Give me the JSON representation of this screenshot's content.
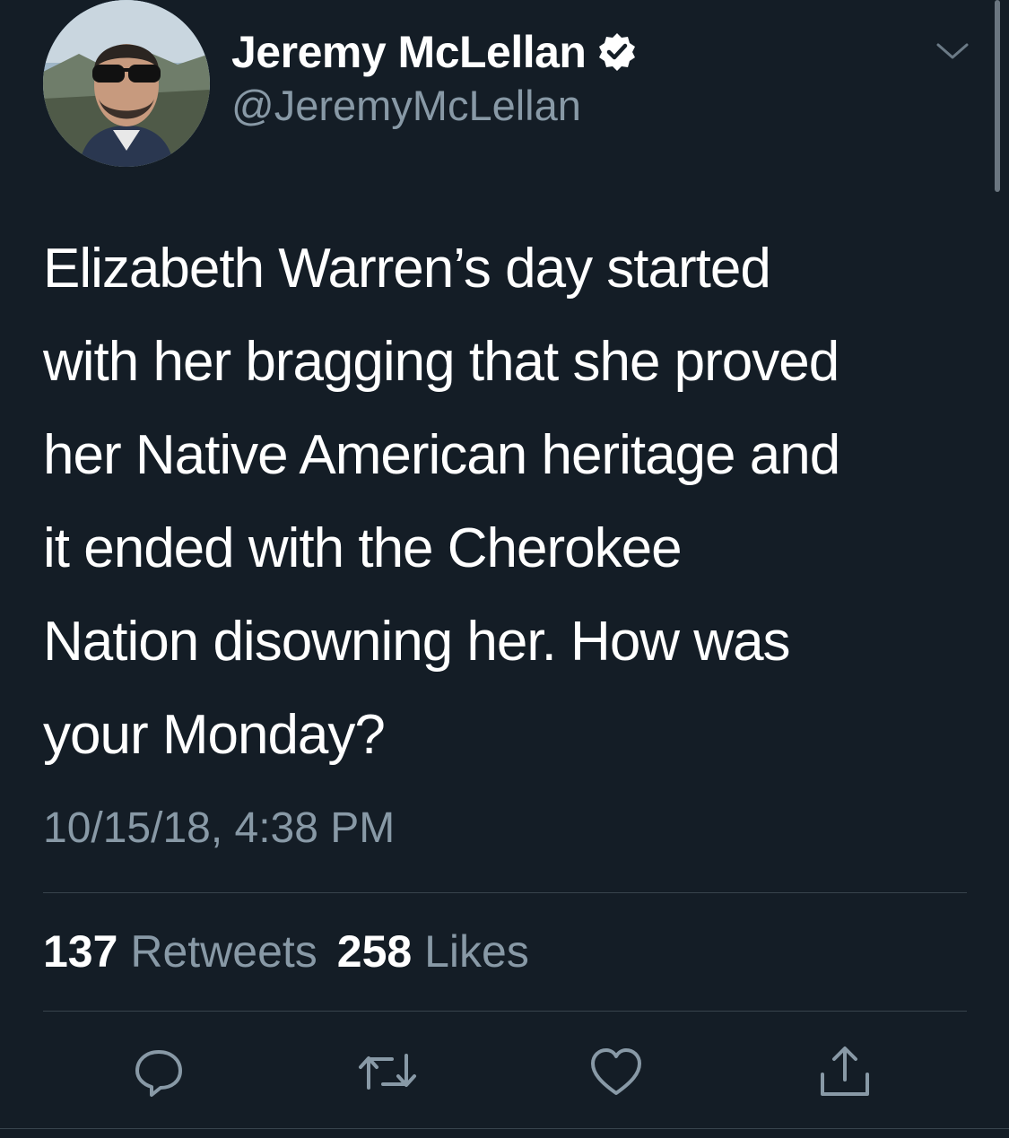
{
  "author": {
    "display_name": "Jeremy McLellan",
    "handle": "@JeremyMcLellan",
    "verified": true
  },
  "tweet": {
    "text": "Elizabeth Warren’s day started\nwith her bragging that she proved\nher Native American heritage and\nit ended with the Cherokee\nNation disowning her. How was\nyour Monday?",
    "timestamp": "10/15/18, 4:38 PM"
  },
  "stats": {
    "retweets_count": "137",
    "retweets_label": "Retweets",
    "likes_count": "258",
    "likes_label": "Likes"
  },
  "actions": [
    {
      "name": "reply",
      "icon": "reply-icon"
    },
    {
      "name": "retweet",
      "icon": "retweet-icon"
    },
    {
      "name": "like",
      "icon": "heart-icon"
    },
    {
      "name": "share",
      "icon": "share-icon"
    }
  ],
  "colors": {
    "background": "#141d26",
    "secondary_text": "#8899a6",
    "divider": "#38444d",
    "verified_badge": "#ffffff"
  }
}
